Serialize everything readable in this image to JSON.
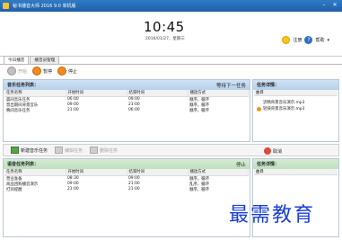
{
  "window": {
    "title": "秘书播音大师 2016 9.0 单机版"
  },
  "header": {
    "clock": "10:45",
    "date": "2016/01/27，星期三",
    "register_label": "注册",
    "help_label": "帮助",
    "help_caret": "▾"
  },
  "tabs": [
    {
      "label": "今日播音"
    },
    {
      "label": "播音员管理"
    }
  ],
  "toolbar": {
    "start_label": "开始",
    "pause_label": "暂停",
    "stop_label": "停止"
  },
  "music_panel": {
    "title": "音乐任务列表：",
    "status": "等待下一任务",
    "columns": [
      "任务名称",
      "开始时间",
      "结束时间",
      "播放方式"
    ],
    "rows": [
      [
        "晨间音乐任务",
        "06:00",
        "09:00",
        "顺序，循环"
      ],
      [
        "晋出期间背景音乐",
        "09:00",
        "21:00",
        "顺序，循环"
      ],
      [
        "晚间音乐任务",
        "21:00",
        "06:00",
        "顺序，循环"
      ]
    ]
  },
  "music_detail": {
    "title": "任务详情：",
    "column": "曲目",
    "files": [
      "流畅背景音乐演示.mp3",
      "轻快背景音乐演示.mp3"
    ]
  },
  "mid_toolbar": {
    "new_label": "新建音乐任务",
    "edit_label": "编辑任务",
    "delete_label": "删除任务",
    "cancel_label": "取消"
  },
  "broadcast_panel": {
    "title": "语音任务列表：",
    "status": "停止",
    "columns": [
      "任务名称",
      "开始时间",
      "结束时间",
      "播放方式"
    ],
    "rows": [
      [
        "营业准备",
        "08:30",
        "09:00",
        "顺序，循环"
      ],
      [
        "商品团购播音演示",
        "09:00",
        "21:00",
        "乱序，循环"
      ],
      [
        "打烊提醒",
        "21:00",
        "21:00",
        "顺序，循环"
      ]
    ]
  },
  "broadcast_detail": {
    "title": "任务详情：",
    "column": "曲目"
  },
  "watermark": "最需教育"
}
